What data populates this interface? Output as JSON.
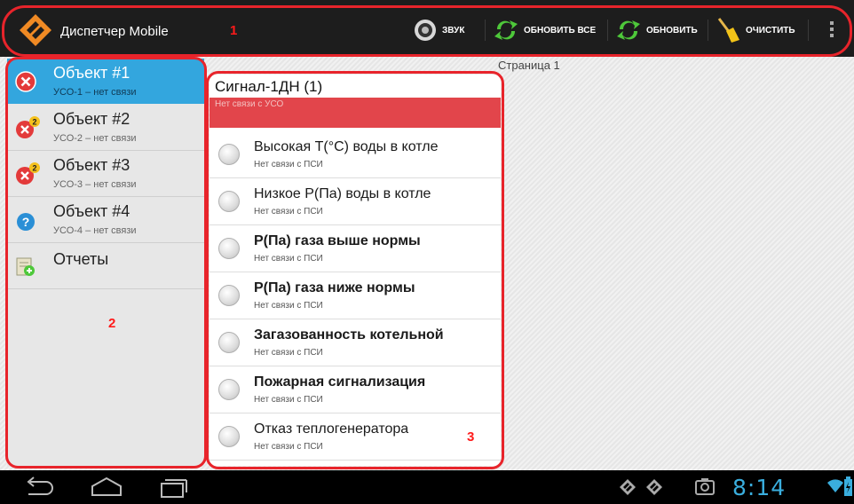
{
  "app": {
    "title": "Диспетчер Mobile",
    "brand_color": "#f08a24"
  },
  "annotations": {
    "one": "1",
    "two": "2",
    "three": "3"
  },
  "toolbar": {
    "sound_label": "ЗВУК",
    "refresh_all_label": "ОБНОВИТЬ ВСЕ",
    "refresh_label": "ОБНОВИТЬ",
    "clear_label": "ОЧИСТИТЬ",
    "overflow_icon": "overflow-menu-icon"
  },
  "sidebar": {
    "items": [
      {
        "title": "Объект #1",
        "sub": "УСО-1 – нет связи",
        "icon": "error-icon",
        "selected": true
      },
      {
        "title": "Объект #2",
        "sub": "УСО-2 – нет связи",
        "icon": "error-badge-icon",
        "badge": "2"
      },
      {
        "title": "Объект #3",
        "sub": "УСО-3 – нет связи",
        "icon": "error-badge-icon",
        "badge": "2"
      },
      {
        "title": "Объект #4",
        "sub": "УСО-4 – нет связи",
        "icon": "question-icon"
      },
      {
        "title": "Отчеты",
        "sub": "",
        "icon": "reports-icon"
      }
    ]
  },
  "page": {
    "label": "Страница 1"
  },
  "signal": {
    "title": "Сигнал-1ДН (1)",
    "status": "Нет связи с УСО",
    "status_color": "#e2454b",
    "rows": [
      {
        "title": "Высокая Т(°С) воды в котле",
        "sub": "Нет связи с ПСИ",
        "bold": false
      },
      {
        "title": "Низкое Р(Па) воды в котле",
        "sub": "Нет связи с ПСИ",
        "bold": false
      },
      {
        "title": "Р(Па) газа выше нормы",
        "sub": "Нет связи с ПСИ",
        "bold": true
      },
      {
        "title": "Р(Па) газа ниже нормы",
        "sub": "Нет связи с ПСИ",
        "bold": true
      },
      {
        "title": "Загазованность котельной",
        "sub": "Нет связи с ПСИ",
        "bold": true
      },
      {
        "title": "Пожарная сигнализация",
        "sub": "Нет связи с ПСИ",
        "bold": true
      },
      {
        "title": "Отказ теплогенератора",
        "sub": "Нет связи с ПСИ",
        "bold": false
      }
    ]
  },
  "statusbar": {
    "time": "8:14",
    "accent": "#3aaede"
  }
}
